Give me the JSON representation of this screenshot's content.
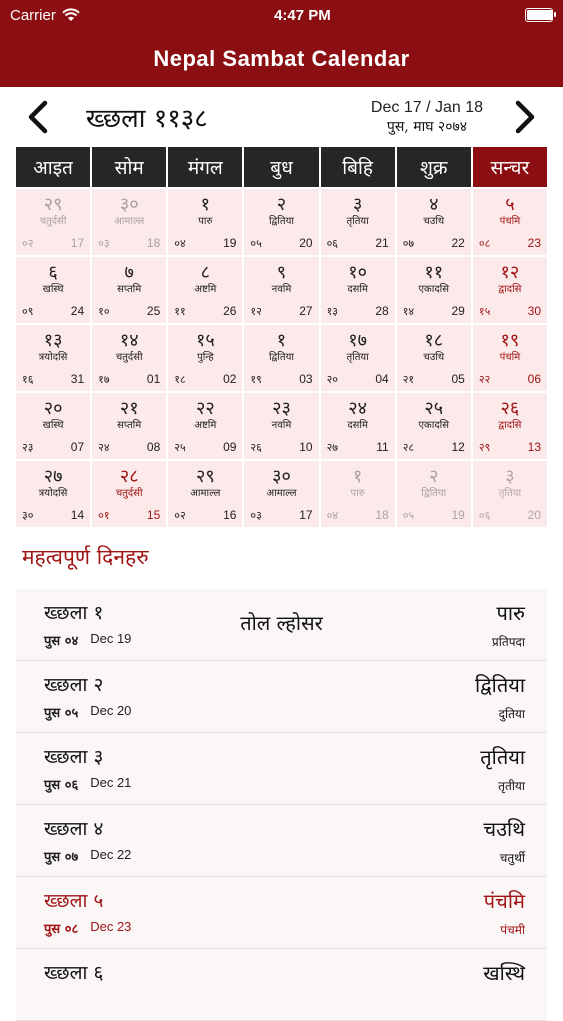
{
  "status": {
    "carrier": "Carrier",
    "time": "4:47 PM",
    "battery_level": 1.0
  },
  "nav": {
    "title": "Nepal Sambat Calendar"
  },
  "month": {
    "title": "ख्छला ११३८",
    "gregorian": "Dec 17 / Jan 18",
    "nepali": "पुस, माघ २०७४"
  },
  "weekdays": [
    "आइत",
    "सोम",
    "मंगल",
    "बुध",
    "बिहि",
    "शुक्र",
    "सन्चर"
  ],
  "calendar": [
    [
      {
        "num": "२९",
        "tithi": "चतुर्दसी",
        "bs": "०२",
        "ad": "17",
        "dim": true
      },
      {
        "num": "३०",
        "tithi": "आमाल्ल",
        "bs": "०३",
        "ad": "18",
        "dim": true
      },
      {
        "num": "१",
        "tithi": "पारु",
        "bs": "०४",
        "ad": "19"
      },
      {
        "num": "२",
        "tithi": "द्वितिया",
        "bs": "०५",
        "ad": "20"
      },
      {
        "num": "३",
        "tithi": "तृतिया",
        "bs": "०६",
        "ad": "21"
      },
      {
        "num": "४",
        "tithi": "चउथि",
        "bs": "०७",
        "ad": "22"
      },
      {
        "num": "५",
        "tithi": "पंचमि",
        "bs": "०८",
        "ad": "23"
      }
    ],
    [
      {
        "num": "६",
        "tithi": "खस्थि",
        "bs": "०९",
        "ad": "24"
      },
      {
        "num": "७",
        "tithi": "सप्तमि",
        "bs": "१०",
        "ad": "25"
      },
      {
        "num": "८",
        "tithi": "अष्टमि",
        "bs": "११",
        "ad": "26"
      },
      {
        "num": "९",
        "tithi": "नवमि",
        "bs": "१२",
        "ad": "27"
      },
      {
        "num": "१०",
        "tithi": "दसमि",
        "bs": "१३",
        "ad": "28"
      },
      {
        "num": "११",
        "tithi": "एकादसि",
        "bs": "१४",
        "ad": "29"
      },
      {
        "num": "१२",
        "tithi": "द्वादसि",
        "bs": "१५",
        "ad": "30"
      }
    ],
    [
      {
        "num": "१३",
        "tithi": "त्रयोदसि",
        "bs": "१६",
        "ad": "31"
      },
      {
        "num": "१४",
        "tithi": "चतुर्दसी",
        "bs": "१७",
        "ad": "01"
      },
      {
        "num": "१५",
        "tithi": "पुन्हि",
        "bs": "१८",
        "ad": "02"
      },
      {
        "num": "१",
        "tithi": "द्वितिया",
        "bs": "१९",
        "ad": "03"
      },
      {
        "num": "१७",
        "tithi": "तृतिया",
        "bs": "२०",
        "ad": "04"
      },
      {
        "num": "१८",
        "tithi": "चउथि",
        "bs": "२१",
        "ad": "05"
      },
      {
        "num": "१९",
        "tithi": "पंचमि",
        "bs": "२२",
        "ad": "06"
      }
    ],
    [
      {
        "num": "२०",
        "tithi": "खस्थि",
        "bs": "२३",
        "ad": "07"
      },
      {
        "num": "२१",
        "tithi": "सप्तमि",
        "bs": "२४",
        "ad": "08"
      },
      {
        "num": "२२",
        "tithi": "अष्टमि",
        "bs": "२५",
        "ad": "09"
      },
      {
        "num": "२३",
        "tithi": "नवमि",
        "bs": "२६",
        "ad": "10"
      },
      {
        "num": "२४",
        "tithi": "दसमि",
        "bs": "२७",
        "ad": "11"
      },
      {
        "num": "२५",
        "tithi": "एकादसि",
        "bs": "२८",
        "ad": "12"
      },
      {
        "num": "२६",
        "tithi": "द्वादसि",
        "bs": "२९",
        "ad": "13"
      }
    ],
    [
      {
        "num": "२७",
        "tithi": "त्रयोदसि",
        "bs": "३०",
        "ad": "14"
      },
      {
        "num": "२८",
        "tithi": "चतुर्दसी",
        "bs": "०१",
        "ad": "15",
        "holiday": true
      },
      {
        "num": "२९",
        "tithi": "आमाल्ल",
        "bs": "०२",
        "ad": "16"
      },
      {
        "num": "३०",
        "tithi": "आमाल्ल",
        "bs": "०३",
        "ad": "17"
      },
      {
        "num": "१",
        "tithi": "पारु",
        "bs": "०४",
        "ad": "18",
        "dim": true
      },
      {
        "num": "२",
        "tithi": "द्वितिया",
        "bs": "०५",
        "ad": "19",
        "dim": true
      },
      {
        "num": "३",
        "tithi": "तृतिया",
        "bs": "०६",
        "ad": "20",
        "dim": true
      }
    ]
  ],
  "important": {
    "title": "महत्वपूर्ण दिनहरु",
    "items": [
      {
        "nsdate": "ख्छला १",
        "bs": "पुस ०४",
        "ad": "Dec 19",
        "event": "तोल ल्होसर",
        "tithi_ne": "पारु",
        "tithi_np": "प्रतिपदा"
      },
      {
        "nsdate": "ख्छला २",
        "bs": "पुस ०५",
        "ad": "Dec 20",
        "event": "",
        "tithi_ne": "द्वितिया",
        "tithi_np": "दुतिया"
      },
      {
        "nsdate": "ख्छला ३",
        "bs": "पुस ०६",
        "ad": "Dec 21",
        "event": "",
        "tithi_ne": "तृतिया",
        "tithi_np": "तृतीया"
      },
      {
        "nsdate": "ख्छला ४",
        "bs": "पुस ०७",
        "ad": "Dec 22",
        "event": "",
        "tithi_ne": "चउथि",
        "tithi_np": "चतुर्थी"
      },
      {
        "nsdate": "ख्छला ५",
        "bs": "पुस ०८",
        "ad": "Dec 23",
        "event": "",
        "tithi_ne": "पंचमि",
        "tithi_np": "पंचमी",
        "saturday": true
      },
      {
        "nsdate": "ख्छला ६",
        "bs": "",
        "ad": "",
        "event": "",
        "tithi_ne": "खस्थि",
        "tithi_np": ""
      }
    ]
  },
  "colors": {
    "brand": "#8b0f12",
    "accent": "#a11516",
    "cell_bg": "#fce9e9",
    "header_bg": "#262626"
  }
}
